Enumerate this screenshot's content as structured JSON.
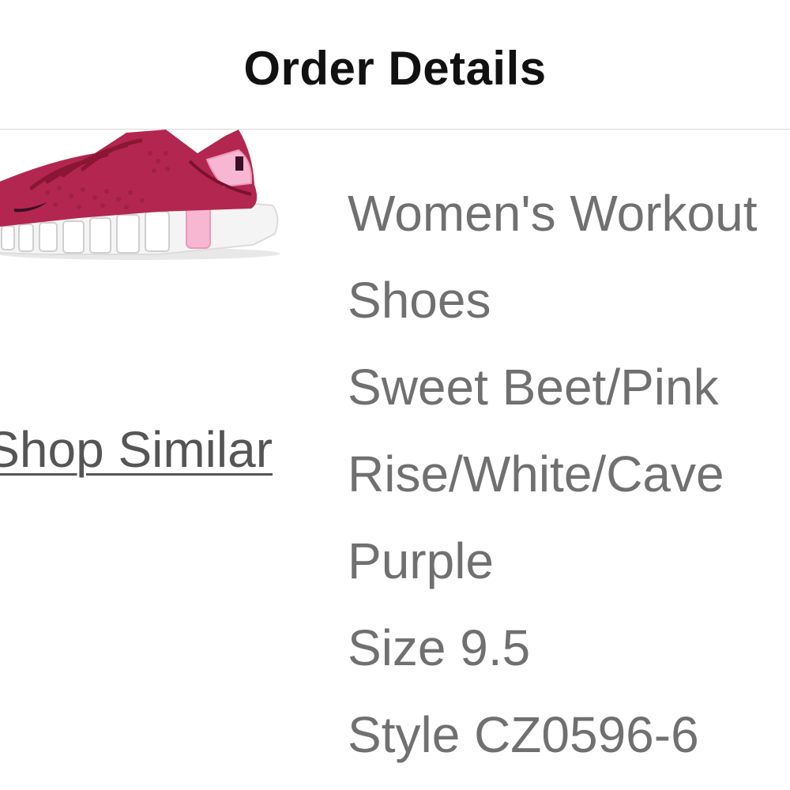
{
  "header": {
    "title": "Order Details"
  },
  "product": {
    "image_icon": "sneaker-image",
    "shop_similar_label": "Shop Similar",
    "name_line_1": "Women's Workout",
    "name_line_2": "Shoes",
    "color_line_1": "Sweet Beet/Pink",
    "color_line_2": "Rise/White/Cave",
    "color_line_3": "Purple",
    "size": "Size 9.5",
    "style": "Style CZ0596-6"
  },
  "colors": {
    "shoe_upper": "#b3264f",
    "shoe_accent": "#f7b6d2",
    "sole": "#f2f2f2",
    "text_primary": "#111111",
    "text_secondary": "#707070",
    "link": "#555555"
  }
}
